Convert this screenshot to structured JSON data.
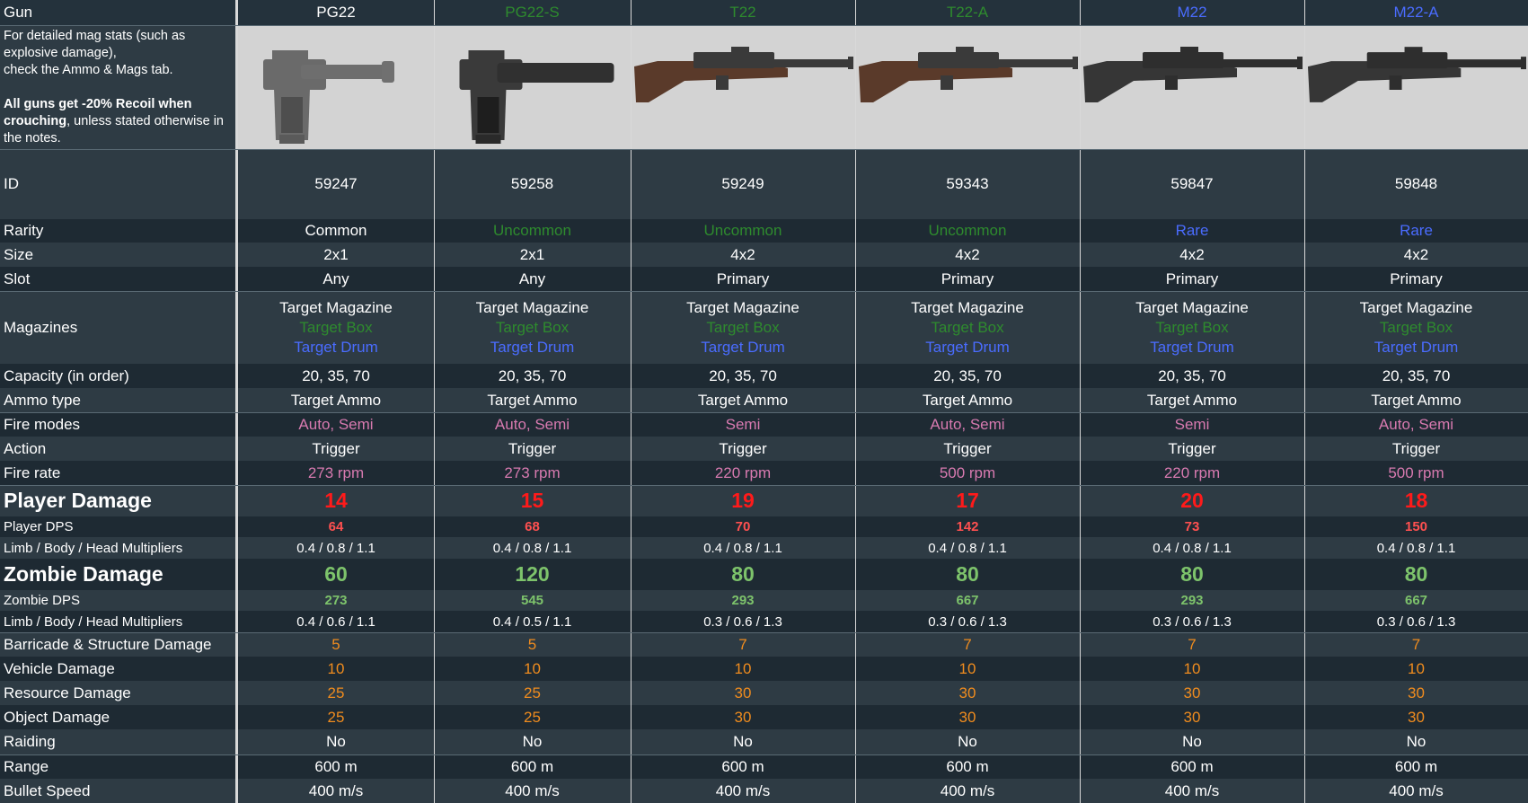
{
  "colors": {
    "white": "#ffffff",
    "uncommon_green": "#2e8b2e",
    "rare_blue": "#4a6cff",
    "pink": "#d87ab0",
    "player_red": "#ff1a1a",
    "dps_red": "#ff5050",
    "zombie_green": "#7dc36b",
    "orange": "#f08c1e"
  },
  "header": {
    "label": "Gun"
  },
  "intro": {
    "line1": "For detailed mag stats (such as explosive damage),",
    "line2": "check the Ammo & Mags tab.",
    "bold1": "All guns get -20% Recoil when crouching",
    "rest": ", unless stated otherwise in the notes."
  },
  "guns": [
    {
      "name": "PG22",
      "name_color": "white",
      "icon": "pistol-icon",
      "id": "59247",
      "rarity": "Common",
      "rarity_color": "white",
      "size": "2x1",
      "slot": "Any",
      "mag1": "Target Magazine",
      "mag2": "Target Box",
      "mag3": "Target Drum",
      "capacity": "20, 35, 70",
      "ammo": "Target Ammo",
      "fire_modes": "Auto, Semi",
      "action": "Trigger",
      "fire_rate": "273 rpm",
      "player_damage": "14",
      "player_dps": "64",
      "player_mult": "0.4 / 0.8 / 1.1",
      "zombie_damage": "60",
      "zombie_dps": "273",
      "zombie_mult": "0.4 / 0.6 / 1.1",
      "barricade": "5",
      "vehicle": "10",
      "resource": "25",
      "object": "25",
      "raiding": "No",
      "range": "600 m",
      "bullet_speed": "400 m/s"
    },
    {
      "name": "PG22-S",
      "name_color": "uncommon_green",
      "icon": "suppressed-pistol-icon",
      "id": "59258",
      "rarity": "Uncommon",
      "rarity_color": "uncommon_green",
      "size": "2x1",
      "slot": "Any",
      "mag1": "Target Magazine",
      "mag2": "Target Box",
      "mag3": "Target Drum",
      "capacity": "20, 35, 70",
      "ammo": "Target Ammo",
      "fire_modes": "Auto, Semi",
      "action": "Trigger",
      "fire_rate": "273 rpm",
      "player_damage": "15",
      "player_dps": "68",
      "player_mult": "0.4 / 0.8 / 1.1",
      "zombie_damage": "120",
      "zombie_dps": "545",
      "zombie_mult": "0.4 / 0.5 / 1.1",
      "barricade": "5",
      "vehicle": "10",
      "resource": "25",
      "object": "25",
      "raiding": "No",
      "range": "600 m",
      "bullet_speed": "400 m/s"
    },
    {
      "name": "T22",
      "name_color": "uncommon_green",
      "icon": "wooden-rifle-icon",
      "id": "59249",
      "rarity": "Uncommon",
      "rarity_color": "uncommon_green",
      "size": "4x2",
      "slot": "Primary",
      "mag1": "Target Magazine",
      "mag2": "Target Box",
      "mag3": "Target Drum",
      "capacity": "20, 35, 70",
      "ammo": "Target Ammo",
      "fire_modes": "Semi",
      "action": "Trigger",
      "fire_rate": "220 rpm",
      "player_damage": "19",
      "player_dps": "70",
      "player_mult": "0.4 / 0.8 / 1.1",
      "zombie_damage": "80",
      "zombie_dps": "293",
      "zombie_mult": "0.3 / 0.6 / 1.3",
      "barricade": "7",
      "vehicle": "10",
      "resource": "30",
      "object": "30",
      "raiding": "No",
      "range": "600 m",
      "bullet_speed": "400 m/s"
    },
    {
      "name": "T22-A",
      "name_color": "uncommon_green",
      "icon": "wooden-rifle-icon",
      "id": "59343",
      "rarity": "Uncommon",
      "rarity_color": "uncommon_green",
      "size": "4x2",
      "slot": "Primary",
      "mag1": "Target Magazine",
      "mag2": "Target Box",
      "mag3": "Target Drum",
      "capacity": "20, 35, 70",
      "ammo": "Target Ammo",
      "fire_modes": "Auto, Semi",
      "action": "Trigger",
      "fire_rate": "500 rpm",
      "player_damage": "17",
      "player_dps": "142",
      "player_mult": "0.4 / 0.8 / 1.1",
      "zombie_damage": "80",
      "zombie_dps": "667",
      "zombie_mult": "0.3 / 0.6 / 1.3",
      "barricade": "7",
      "vehicle": "10",
      "resource": "30",
      "object": "30",
      "raiding": "No",
      "range": "600 m",
      "bullet_speed": "400 m/s"
    },
    {
      "name": "M22",
      "name_color": "rare_blue",
      "icon": "black-rifle-icon",
      "id": "59847",
      "rarity": "Rare",
      "rarity_color": "rare_blue",
      "size": "4x2",
      "slot": "Primary",
      "mag1": "Target Magazine",
      "mag2": "Target Box",
      "mag3": "Target Drum",
      "capacity": "20, 35, 70",
      "ammo": "Target Ammo",
      "fire_modes": "Semi",
      "action": "Trigger",
      "fire_rate": "220 rpm",
      "player_damage": "20",
      "player_dps": "73",
      "player_mult": "0.4 / 0.8 / 1.1",
      "zombie_damage": "80",
      "zombie_dps": "293",
      "zombie_mult": "0.3 / 0.6 / 1.3",
      "barricade": "7",
      "vehicle": "10",
      "resource": "30",
      "object": "30",
      "raiding": "No",
      "range": "600 m",
      "bullet_speed": "400 m/s"
    },
    {
      "name": "M22-A",
      "name_color": "rare_blue",
      "icon": "black-rifle-icon",
      "id": "59848",
      "rarity": "Rare",
      "rarity_color": "rare_blue",
      "size": "4x2",
      "slot": "Primary",
      "mag1": "Target Magazine",
      "mag2": "Target Box",
      "mag3": "Target Drum",
      "capacity": "20, 35, 70",
      "ammo": "Target Ammo",
      "fire_modes": "Auto, Semi",
      "action": "Trigger",
      "fire_rate": "500 rpm",
      "player_damage": "18",
      "player_dps": "150",
      "player_mult": "0.4 / 0.8 / 1.1",
      "zombie_damage": "80",
      "zombie_dps": "667",
      "zombie_mult": "0.3 / 0.6 / 1.3",
      "barricade": "7",
      "vehicle": "10",
      "resource": "30",
      "object": "30",
      "raiding": "No",
      "range": "600 m",
      "bullet_speed": "400 m/s"
    }
  ],
  "rows": [
    {
      "key": "id",
      "label": "ID",
      "color": "white"
    },
    {
      "key": "rarity",
      "label": "Rarity",
      "color_key": "rarity_color"
    },
    {
      "key": "size",
      "label": "Size",
      "color": "white"
    },
    {
      "key": "slot",
      "label": "Slot",
      "color": "white"
    },
    {
      "key": "mags",
      "label": "Magazines"
    },
    {
      "key": "capacity",
      "label": "Capacity (in order)",
      "color": "white"
    },
    {
      "key": "ammo",
      "label": "Ammo type",
      "color": "white"
    },
    {
      "key": "fire_modes",
      "label": "Fire modes",
      "color": "pink"
    },
    {
      "key": "action",
      "label": "Action",
      "color": "white"
    },
    {
      "key": "fire_rate",
      "label": "Fire rate",
      "color": "pink"
    },
    {
      "key": "player_damage",
      "label": "Player Damage",
      "color": "player_red",
      "style": "big"
    },
    {
      "key": "player_dps",
      "label": "Player DPS",
      "color": "dps_red",
      "style": "small"
    },
    {
      "key": "player_mult",
      "label": "Limb / Body / Head Multipliers",
      "color": "white",
      "style": "smallplain"
    },
    {
      "key": "zombie_damage",
      "label": "Zombie Damage",
      "color": "zombie_green",
      "style": "big"
    },
    {
      "key": "zombie_dps",
      "label": "Zombie DPS",
      "color": "zombie_green",
      "style": "small"
    },
    {
      "key": "zombie_mult",
      "label": "Limb / Body / Head Multipliers",
      "color": "white",
      "style": "smallplain"
    },
    {
      "key": "barricade",
      "label": "Barricade & Structure Damage",
      "color": "orange"
    },
    {
      "key": "vehicle",
      "label": "Vehicle Damage",
      "color": "orange"
    },
    {
      "key": "resource",
      "label": "Resource Damage",
      "color": "orange"
    },
    {
      "key": "object",
      "label": "Object Damage",
      "color": "orange"
    },
    {
      "key": "raiding",
      "label": "Raiding",
      "color": "white"
    },
    {
      "key": "range",
      "label": "Range",
      "color": "white"
    },
    {
      "key": "bullet_speed",
      "label": "Bullet Speed",
      "color": "white"
    }
  ]
}
